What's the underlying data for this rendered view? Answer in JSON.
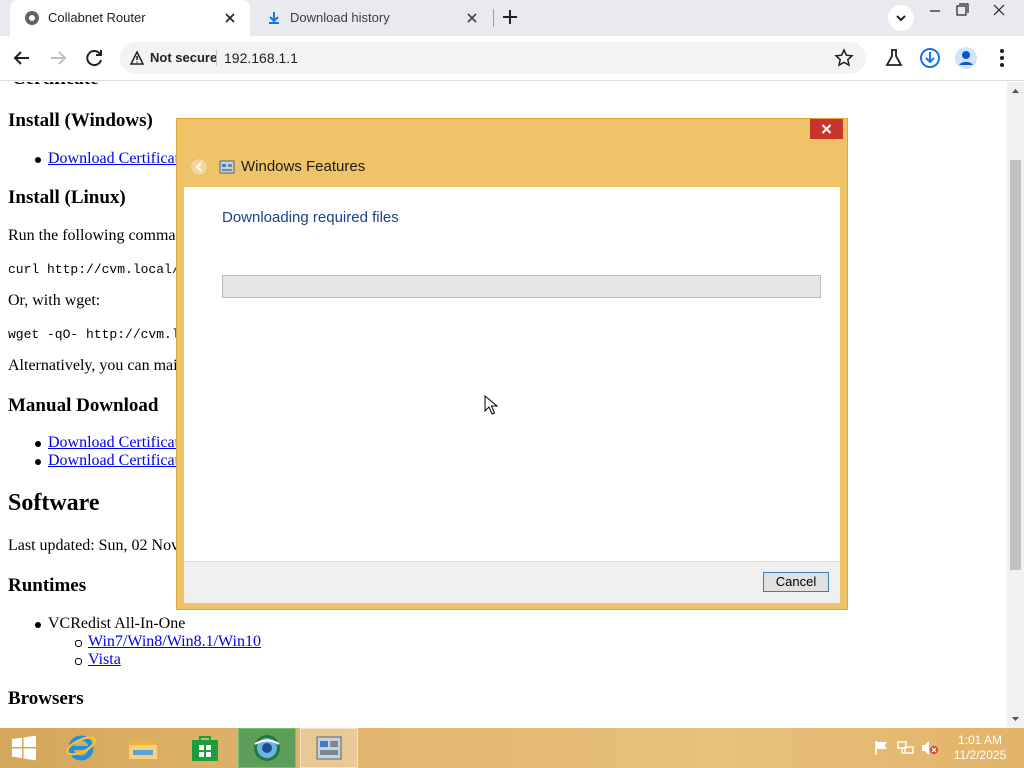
{
  "browser": {
    "tabs": [
      {
        "label": "Collabnet Router",
        "icon": "globe-icon",
        "active": true
      },
      {
        "label": "Download history",
        "icon": "download-icon",
        "active": false
      }
    ],
    "address": {
      "security_label": "Not secure",
      "url": "192.168.1.1"
    }
  },
  "page": {
    "cut_heading": "Certificate",
    "install_windows": "Install (Windows)",
    "download_cert_1": "Download Certificat",
    "install_linux": "Install (Linux)",
    "run_following": "Run the following comma",
    "curl_cmd": "curl http://cvm.local/l",
    "or_wget": "Or, with wget:",
    "wget_cmd": "wget -qO- http://cvm.loc",
    "alternatively": "Alternatively, you can mai",
    "manual_download": "Manual Download",
    "download_cert_2": "Download Certificat",
    "download_cert_3": "Download Certificat",
    "software": "Software",
    "last_updated": "Last updated: Sun, 02 Nov",
    "runtimes": "Runtimes",
    "vcredist": "VCRedist All-In-One",
    "win_link": "Win7/Win8/Win8.1/Win10",
    "vista_link": "Vista",
    "browsers": "Browsers"
  },
  "dialog": {
    "title": "Windows Features",
    "heading": "Downloading required files",
    "progress": 0,
    "cancel_label": "Cancel"
  },
  "taskbar": {
    "items": [
      "start-icon",
      "internet-explorer-icon",
      "file-explorer-icon",
      "store-icon",
      "browser-icon",
      "windows-features-icon"
    ],
    "time": "1:01 AM",
    "date": "11/2/2025"
  },
  "colors": {
    "dialog_frame": "#efc468",
    "dialog_heading": "#1e3f8a",
    "link": "#0000ee",
    "close_red": "#c7352c"
  }
}
